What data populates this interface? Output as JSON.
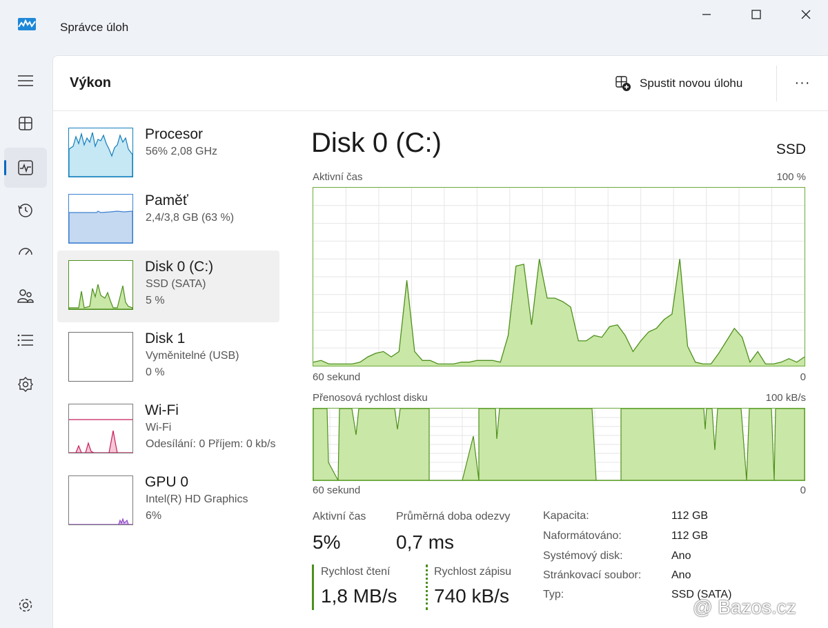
{
  "window": {
    "title": "Správce úloh"
  },
  "header": {
    "title": "Výkon",
    "run_task_label": "Spustit novou úlohu",
    "more_label": "···"
  },
  "nav": [
    "menu-icon",
    "processes-icon",
    "performance-icon",
    "app-history-icon",
    "startup-icon",
    "users-icon",
    "details-icon",
    "services-icon",
    "settings-icon"
  ],
  "devices": [
    {
      "name": "Procesor",
      "line1": "56% 2,08 GHz",
      "line2": ""
    },
    {
      "name": "Paměť",
      "line1": "2,4/3,8 GB (63 %)",
      "line2": ""
    },
    {
      "name": "Disk 0 (C:)",
      "line1": "SSD (SATA)",
      "line2": "5 %"
    },
    {
      "name": "Disk 1",
      "line1": "Vyměnitelné (USB)",
      "line2": "0 %"
    },
    {
      "name": "Wi-Fi",
      "line1": "Wi-Fi",
      "line2": "Odesílání: 0 Příjem: 0 kb/s"
    },
    {
      "name": "GPU 0",
      "line1": "Intel(R) HD Graphics",
      "line2": "6%"
    }
  ],
  "detail": {
    "title": "Disk 0 (C:)",
    "type": "SSD",
    "chart1": {
      "label": "Aktivní čas",
      "max": "100 %",
      "xlabel": "60 sekund",
      "min": "0"
    },
    "chart2": {
      "label": "Přenosová rychlost disku",
      "max": "100 kB/s",
      "xlabel": "60 sekund",
      "min": "0"
    },
    "stats": {
      "active_label": "Aktivní čas",
      "active_value": "5%",
      "response_label": "Průměrná doba odezvy",
      "response_value": "0,7 ms",
      "read_label": "Rychlost čtení",
      "read_value": "1,8 MB/s",
      "write_label": "Rychlost zápisu",
      "write_value": "740 kB/s"
    },
    "props": [
      {
        "k": "Kapacita:",
        "v": "112 GB"
      },
      {
        "k": "Naformátováno:",
        "v": "112 GB"
      },
      {
        "k": "Systémový disk:",
        "v": "Ano"
      },
      {
        "k": "Stránkovací soubor:",
        "v": "Ano"
      },
      {
        "k": "Typ:",
        "v": "SSD (SATA)"
      }
    ]
  },
  "chart_data": {
    "type": "area",
    "title": "Aktivní čas",
    "ylim": [
      0,
      100
    ],
    "values": [
      2,
      3,
      1,
      1,
      1,
      1,
      2,
      5,
      7,
      8,
      5,
      8,
      48,
      8,
      3,
      3,
      1,
      1,
      1,
      2,
      2,
      3,
      3,
      3,
      2,
      17,
      56,
      57,
      23,
      60,
      38,
      38,
      36,
      33,
      14,
      14,
      17,
      16,
      22,
      23,
      17,
      8,
      14,
      19,
      21,
      26,
      29,
      60,
      11,
      2,
      1,
      1,
      7,
      14,
      21,
      16,
      2,
      8,
      1,
      1,
      2,
      4,
      2,
      5
    ]
  },
  "colors": {
    "accent": "#0067c0",
    "disk_line": "#4d8f1c",
    "disk_fill": "#c9e7a6",
    "cpu": "#117dbb",
    "mem": "#3d7fd1",
    "wifi": "#c71e5c",
    "gpu": "#8e44c4"
  },
  "watermark": "@ Bazos.cz"
}
